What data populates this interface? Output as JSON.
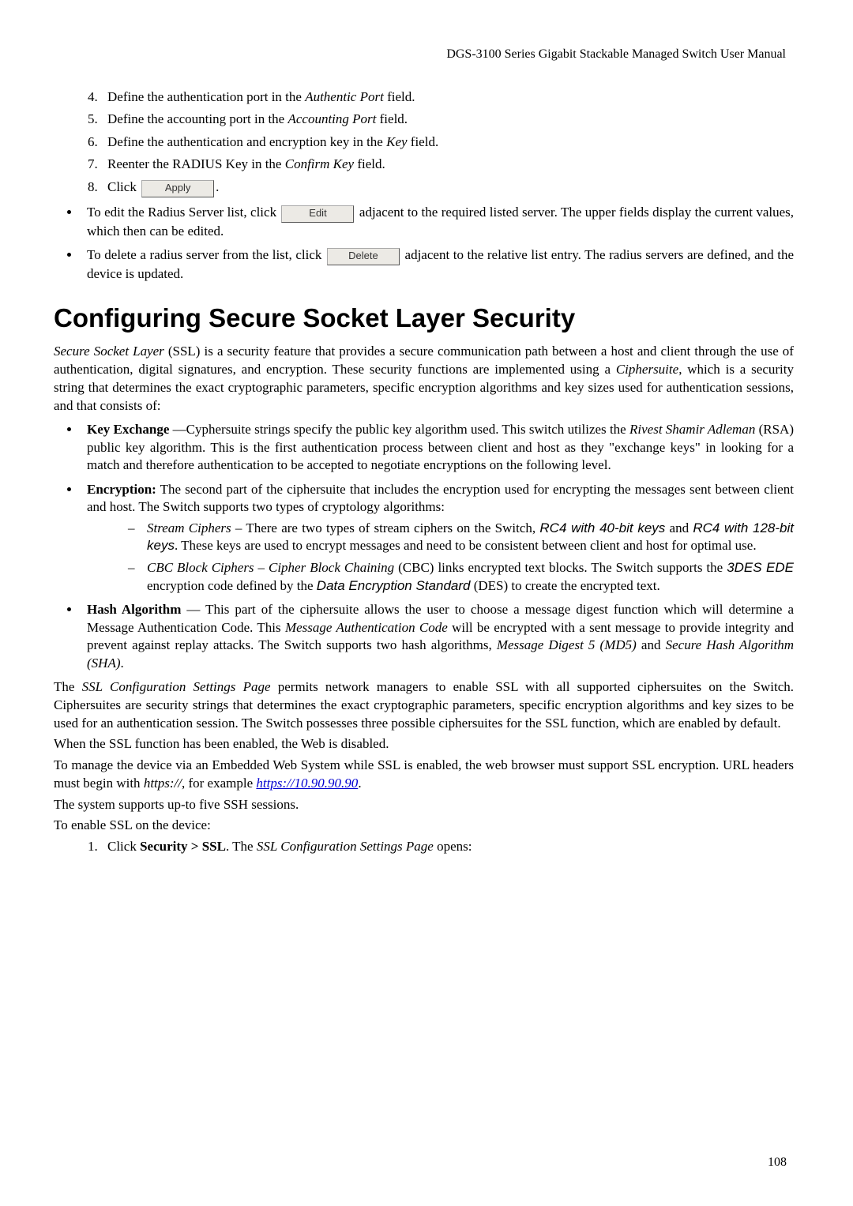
{
  "header_runner": "DGS-3100 Series Gigabit Stackable Managed Switch User Manual",
  "page_number": "108",
  "steps": {
    "s4_a": "Define the authentication port in the ",
    "s4_i": "Authentic Port",
    "s4_b": " field.",
    "s5_a": "Define the accounting port in the ",
    "s5_i": "Accounting Port",
    "s5_b": " field.",
    "s6_a": "Define the authentication and encryption key in the ",
    "s6_i": "Key",
    "s6_b": " field.",
    "s7_a": "Reenter the RADIUS Key in the ",
    "s7_i": "Confirm Key",
    "s7_b": " field.",
    "s8_a": "Click ",
    "s8_btn": "Apply",
    "s8_b": "."
  },
  "edit_bullet": {
    "a": "To edit the Radius Server list, click ",
    "btn": "Edit",
    "b": " adjacent to the required listed server. The upper fields display the current values, which then can be edited."
  },
  "delete_bullet": {
    "a": "To delete a radius server from the list, click ",
    "btn": "Delete",
    "b": " adjacent to the relative list entry. The radius servers are defined, and the device is updated."
  },
  "section_title": "Configuring Secure Socket Layer Security",
  "intro": {
    "ssl": "Secure Socket Layer",
    "a": " (SSL) is a security feature that provides a secure communication path between a host and client through the use of authentication, digital signatures, and encryption. These security functions are implemented using a ",
    "cipher": "Ciphersuite",
    "b": ", which is a security string that determines the exact cryptographic parameters, specific encryption algorithms and key sizes used for authentication sessions, and that consists of:"
  },
  "ke": {
    "head": "Key Exchange ",
    "a": "—Cyphersuite strings specify the public key algorithm used. This switch utilizes the ",
    "rsa_i": "Rivest Shamir Adleman",
    "b": " (RSA) public key algorithm. This is the first authentication process between client and host as they \"exchange keys\" in looking for a match and therefore authentication to be accepted to negotiate encryptions on the following level."
  },
  "enc": {
    "head": "Encryption:",
    "a": " The second part of the ciphersuite that includes the encryption used for encrypting the messages sent between client and host. The Switch supports two types of cryptology algorithms:"
  },
  "stream": {
    "head": "Stream Ciphers",
    "a": " – There are two types of stream ciphers on the Switch, ",
    "rc4a": "RC4 with 40-bit keys",
    "and": " and ",
    "rc4b": "RC4 with 128-bit keys",
    "b": ". These keys are used to encrypt messages and need to be consistent between client and host for optimal use."
  },
  "cbc": {
    "head": "CBC Block Ciphers – Cipher Block Chaining",
    "a": " (CBC) links encrypted text blocks. The Switch supports the ",
    "tdes": "3DES EDE",
    "b": " encryption code defined by the ",
    "des": "Data Encryption Standard",
    "c": " (DES) to create the encrypted text."
  },
  "hash": {
    "head": "Hash Algorithm ",
    "a": "— This part of the ciphersuite allows the user to choose a message digest function which will determine a Message Authentication Code. This ",
    "mac": "Message Authentication Code",
    "b": " will be encrypted with a sent message to provide integrity and prevent against replay attacks. The Switch supports two hash algorithms, ",
    "md5": "Message Digest 5 (MD5)",
    "and": " and ",
    "sha": "Secure Hash Algorithm (SHA)",
    "c": "."
  },
  "para_sslpage": {
    "a": "The ",
    "i": "SSL Configuration Settings Page",
    "b": " permits network managers to enable SSL with all supported ciphersuites on the Switch. Ciphersuites are security strings that determines the exact cryptographic parameters, specific encryption algorithms and key sizes to be used for an authentication session. The Switch possesses three possible ciphersuites for the SSL function, which are enabled by default."
  },
  "para_webdis": "When the SSL function has been enabled, the Web is disabled.",
  "para_embed": {
    "a": "To manage the device via an Embedded Web System while SSL is enabled, the web browser must support SSL encryption. URL headers must begin with ",
    "https": "https://",
    "b": ", for example ",
    "url": "https://10.90.90.90",
    "c": "."
  },
  "para_ssh": "The system supports up-to five SSH sessions.",
  "para_enable": "To enable SSL on the device:",
  "step1": {
    "a": "Click ",
    "bold": "Security > SSL",
    "b": ". The ",
    "i": "SSL Configuration Settings Page",
    "c": " opens:"
  }
}
